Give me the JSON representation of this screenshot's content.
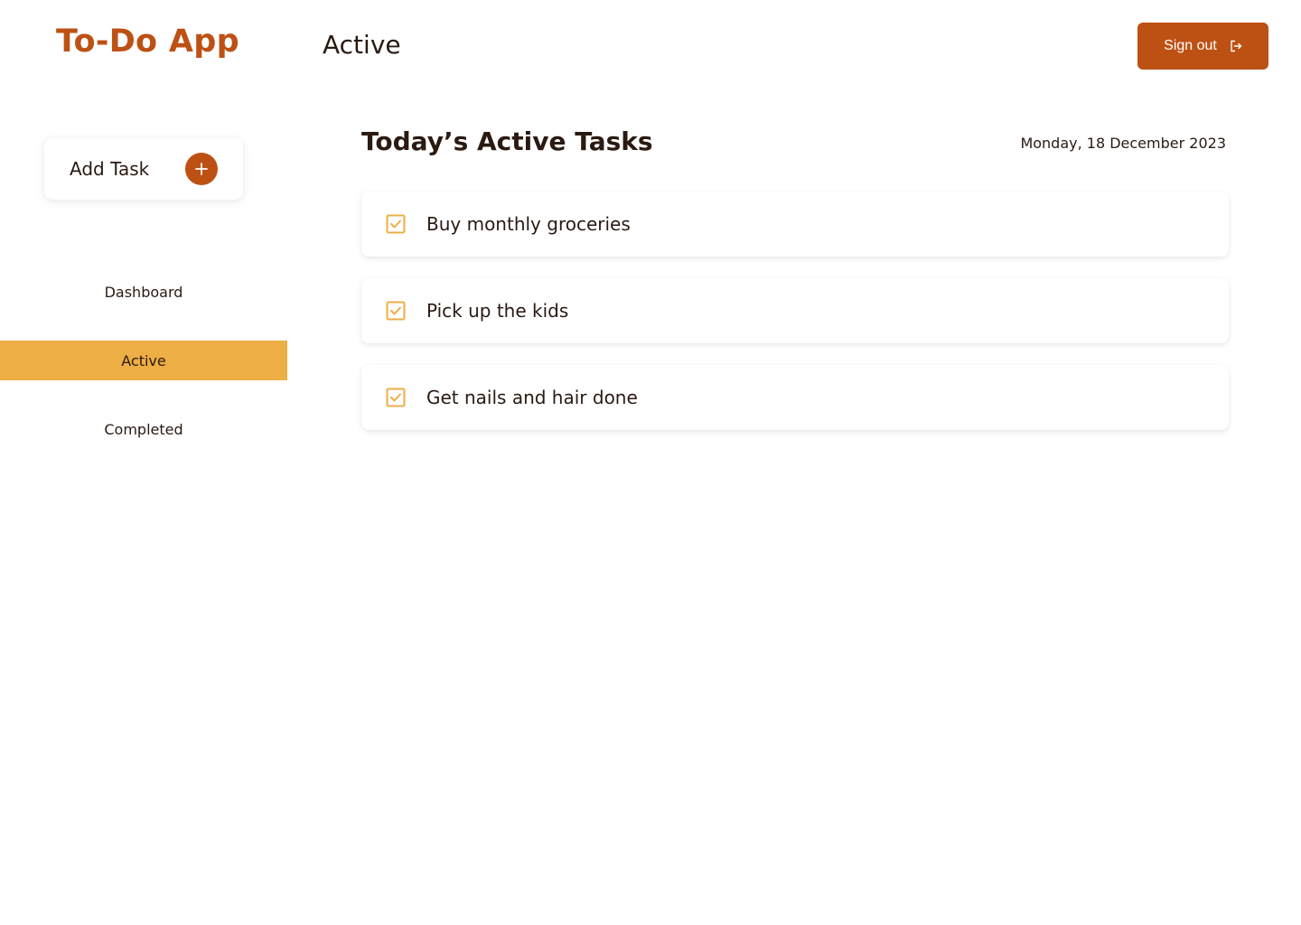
{
  "app": {
    "title": "To-Do App"
  },
  "header": {
    "page_title": "Active",
    "signout_label": "Sign out"
  },
  "sidebar": {
    "add_task_label": "Add Task",
    "items": [
      {
        "label": "Dashboard",
        "active": false
      },
      {
        "label": "Active",
        "active": true
      },
      {
        "label": "Completed",
        "active": false
      }
    ]
  },
  "main": {
    "section_title": "Today’s Active Tasks",
    "date": "Monday, 18 December 2023",
    "tasks": [
      {
        "text": "Buy monthly groceries",
        "checked": true
      },
      {
        "text": "Pick up the kids",
        "checked": true
      },
      {
        "text": "Get nails and hair done",
        "checked": true
      }
    ]
  },
  "colors": {
    "brand": "#bd5114",
    "accent": "#edae45",
    "text": "#2a1a12"
  },
  "icons": {
    "add": "plus-icon",
    "signout": "sign-out-icon",
    "task": "checkbox-checked-icon"
  }
}
